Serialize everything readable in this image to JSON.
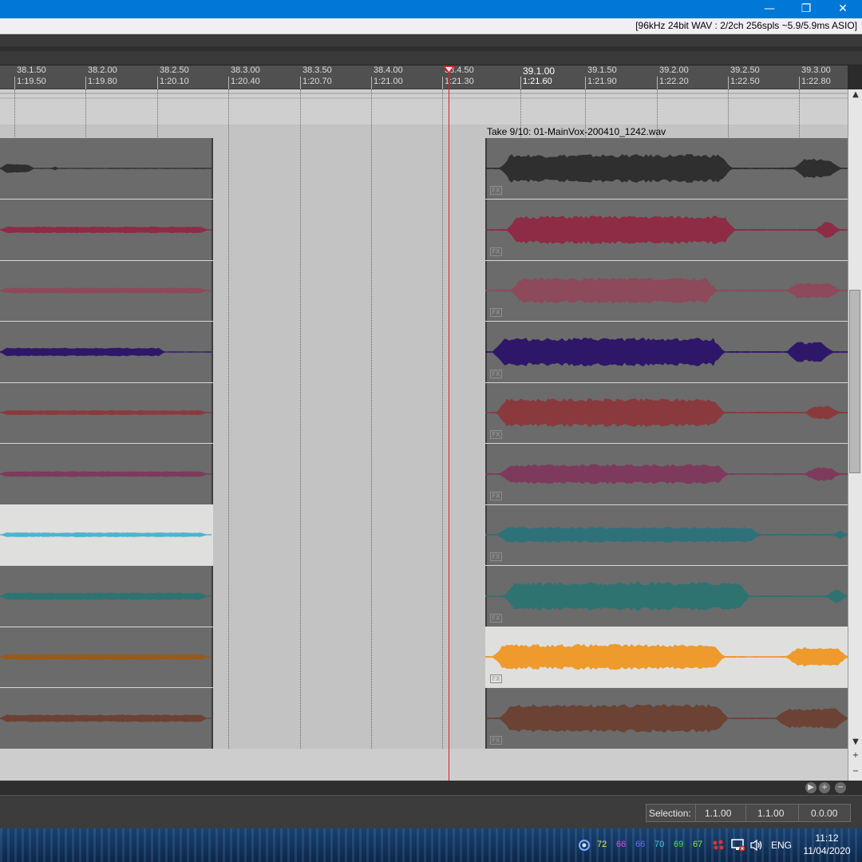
{
  "window": {
    "minimize_glyph": "—",
    "restore_glyph": "❐",
    "close_glyph": "✕"
  },
  "status": {
    "audio_info": "[96kHz 24bit WAV : 2/2ch 256spls ~5.9/5.9ms ASIO]"
  },
  "ruler": {
    "ticks": [
      {
        "beat": "38.1.50",
        "time": "1:19.50",
        "major": false
      },
      {
        "beat": "38.2.00",
        "time": "1:19.80",
        "major": false
      },
      {
        "beat": "38.2.50",
        "time": "1:20.10",
        "major": false
      },
      {
        "beat": "38.3.00",
        "time": "1:20.40",
        "major": false
      },
      {
        "beat": "38.3.50",
        "time": "1:20.70",
        "major": false
      },
      {
        "beat": "38.4.00",
        "time": "1:21.00",
        "major": false
      },
      {
        "beat": "38.4.50",
        "time": "1:21.30",
        "major": false
      },
      {
        "beat": "39.1.00",
        "time": "1:21.60",
        "major": true
      },
      {
        "beat": "39.1.50",
        "time": "1:21.90",
        "major": false
      },
      {
        "beat": "39.2.00",
        "time": "1:22.20",
        "major": false
      },
      {
        "beat": "39.2.50",
        "time": "1:22.50",
        "major": false
      },
      {
        "beat": "39.3.00",
        "time": "1:22.80",
        "major": false
      }
    ]
  },
  "clip_right": {
    "title": "Take 9/10: 01-MainVox-200410_1242.wav"
  },
  "lanes": [
    {
      "color": "#2f2f2f",
      "selected": false,
      "fx": "FX"
    },
    {
      "color": "#8e2b45",
      "selected": false,
      "fx": "FX"
    },
    {
      "color": "#8c4a5b",
      "selected": false,
      "fx": "FX"
    },
    {
      "color": "#2e1668",
      "selected": false,
      "fx": "FX"
    },
    {
      "color": "#8a3a3c",
      "selected": false,
      "fx": "FX"
    },
    {
      "color": "#7e3a5c",
      "selected": false,
      "fx": "FX"
    },
    {
      "color": "#2f7179",
      "selected": false,
      "fx": "FX"
    },
    {
      "color": "#2f7370",
      "selected": false,
      "fx": "FX"
    },
    {
      "color": "#ee9a2c",
      "selected": true,
      "fx": "FX",
      "left_color": "#a0512a"
    },
    {
      "color": "#6b4234",
      "selected": false,
      "fx": "FX"
    }
  ],
  "left_lane_overrides": [
    {
      "color": "#2f2f2f",
      "selected": false
    },
    {
      "color": "#8e2b45",
      "selected": false
    },
    {
      "color": "#8c4a5b",
      "selected": false
    },
    {
      "color": "#2e1668",
      "selected": false
    },
    {
      "color": "#8a3a3c",
      "selected": false
    },
    {
      "color": "#7e3a5c",
      "selected": false
    },
    {
      "color": "#4fb3d0",
      "selected": true
    },
    {
      "color": "#2f7370",
      "selected": false
    },
    {
      "color": "#9a5a18",
      "selected": false
    },
    {
      "color": "#6b4234",
      "selected": false
    }
  ],
  "scroll": {
    "up": "▲",
    "down": "▼",
    "zoom_in": "+",
    "zoom_out": "−",
    "h_right": "▶",
    "h_plus": "+",
    "h_minus": "−"
  },
  "selection": {
    "label": "Selection:",
    "start": "1.1.00",
    "end": "1.1.00",
    "length": "0.0.00"
  },
  "taskbar": {
    "tray_numbers": [
      {
        "value": "72",
        "color": "#e8e84a"
      },
      {
        "value": "66",
        "color": "#e04ae0"
      },
      {
        "value": "66",
        "color": "#6a6aff"
      },
      {
        "value": "70",
        "color": "#4ac8e8"
      },
      {
        "value": "69",
        "color": "#4ae04a"
      },
      {
        "value": "67",
        "color": "#8ae84a"
      }
    ],
    "language": "ENG",
    "time": "11:12",
    "date": "11/04/2020"
  }
}
